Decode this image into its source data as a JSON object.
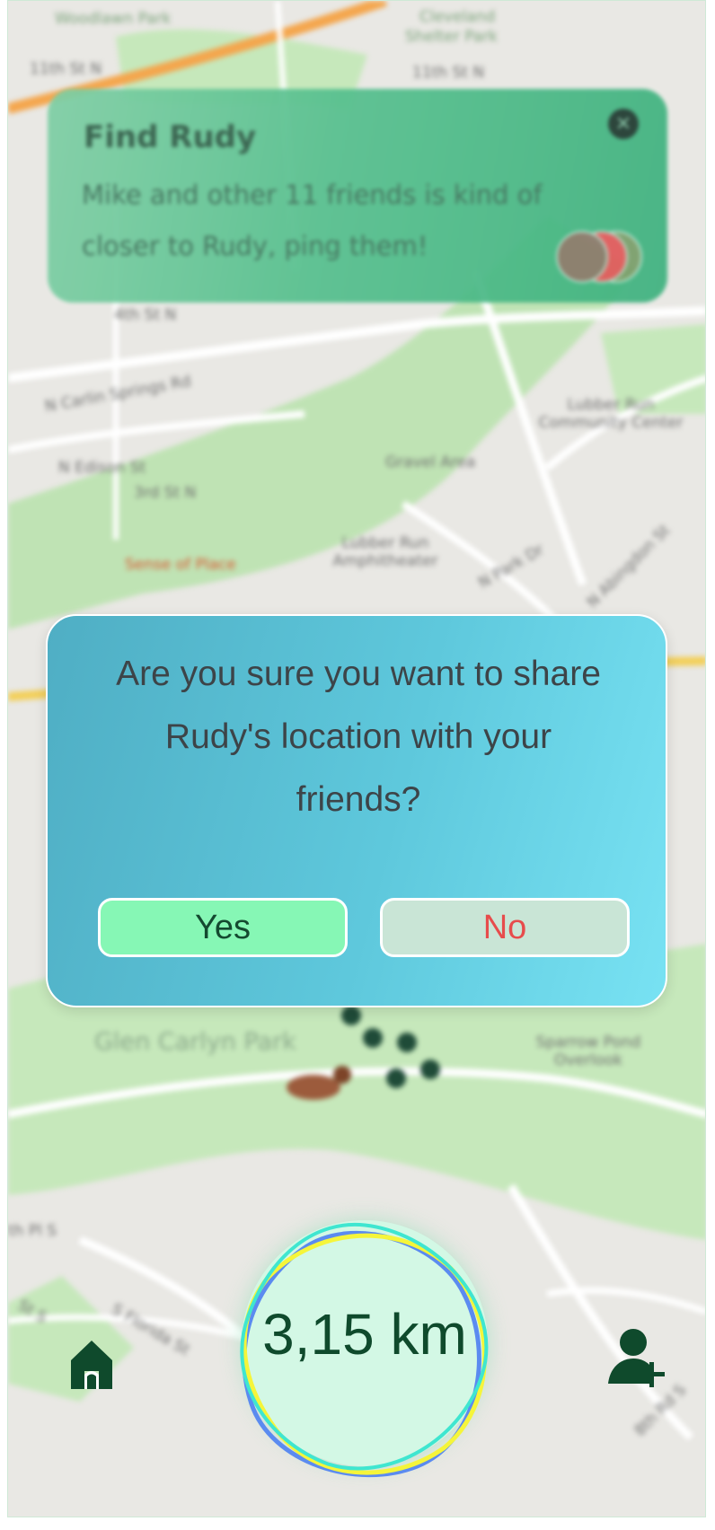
{
  "map": {
    "labels": {
      "weedom_park": "Woodlawn Park",
      "cleveland_park": "Cleveland",
      "shelter_park": "Shelter Park",
      "st_11th": "11th St N",
      "st_11th_b": "11th St N",
      "st_4th": "4th St N",
      "carlin_springs": "N Carlin Springs Rd",
      "edison": "N Edison St",
      "third_st": "3rd St N",
      "sense_of_place": "Sense of Place",
      "amphitheater": "Lubber Run Amphitheater",
      "gravel_area": "Gravel Area",
      "community_center": "Lubber Run Community Center",
      "park_dr": "N Park Dr",
      "abingdon": "N Abingdon St",
      "glen_carlyn": "Glen Carlyn Park",
      "sparrow_pond": "Sparrow Pond Overlook",
      "florida_st": "S Florida St",
      "pl_s": "th Pl S",
      "st_s": "St S",
      "rd_s": "8th Rd S"
    }
  },
  "notification": {
    "title": "Find Rudy",
    "message": "Mike and other 11 friends is kind of closer to Rudy, ping them!",
    "close_label": "×"
  },
  "dialog": {
    "question": "Are you sure you want to share Rudy's location with your friends?",
    "yes_label": "Yes",
    "no_label": "No"
  },
  "distance": {
    "value": "3,15 km"
  },
  "nav": {
    "home_icon": "home-icon",
    "add_friend_icon": "add-friend-icon"
  },
  "colors": {
    "accent_green": "#0f4a2c",
    "yes_bg": "#86f7b5",
    "no_text": "#e74c4c",
    "dialog_start": "#4faec4",
    "dialog_end": "#78e2f3",
    "notif_bg": "#56c08e"
  }
}
